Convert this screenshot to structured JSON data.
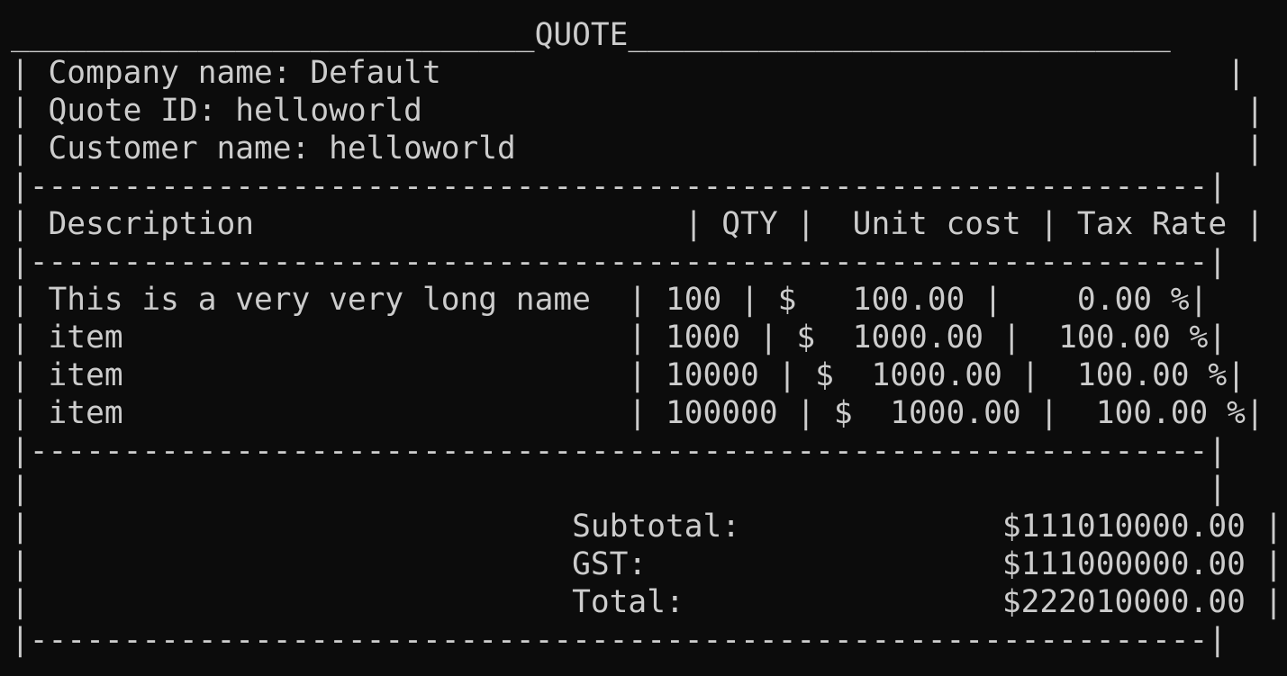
{
  "terminal": {
    "title_line": "____________________________QUOTE_____________________________",
    "company_line": "| Company name: Default                                          |",
    "quote_id_line": "| Quote ID: helloworld                                            |",
    "customer_line": "| Customer name: helloworld                                       |",
    "separator_1": "|---------------------------------------------------------------|",
    "header_line": "| Description                       | QTY |  Unit cost | Tax Rate |",
    "separator_2": "|---------------------------------------------------------------|",
    "rows": [
      "| This is a very very long name  | 100 | $   100.00 |    0.00 %|",
      "| item                           | 1000 | $  1000.00 |  100.00 %|",
      "| item                           | 10000 | $  1000.00 |  100.00 %|",
      "| item                           | 100000 | $  1000.00 |  100.00 %|"
    ],
    "separator_3": "|---------------------------------------------------------------|",
    "blank_line": "|                                                               |",
    "subtotal_line": "|                             Subtotal:              $111010000.00 |",
    "gst_line": "|                             GST:                   $111000000.00 |",
    "total_line": "|                             Total:                 $222010000.00 |",
    "separator_4": "|---------------------------------------------------------------|"
  }
}
